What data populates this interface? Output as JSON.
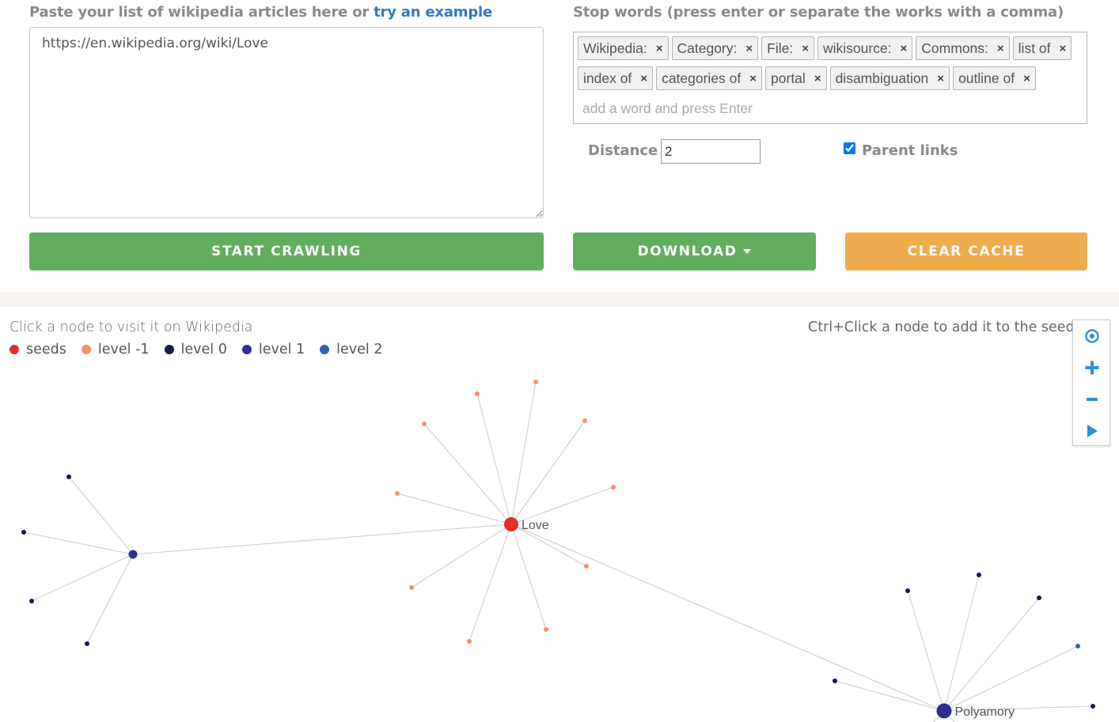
{
  "input_panel": {
    "heading_text": "Paste your list of wikipedia articles here or ",
    "example_link": "try an example",
    "articles_value": "https://en.wikipedia.org/wiki/Love"
  },
  "stopwords_panel": {
    "heading": "Stop words (press enter or separate the works with a comma)",
    "tags": [
      "Wikipedia:",
      "Category:",
      "File:",
      "wikisource:",
      "Commons:",
      "list of",
      "index of",
      "categories of",
      "portal",
      "disambiguation",
      "outline of"
    ],
    "remove_glyph": "×",
    "placeholder": "add a word and press Enter"
  },
  "options": {
    "distance_label": "Distance",
    "distance_value": "2",
    "parent_links_label": "Parent links",
    "parent_links_checked": true
  },
  "buttons": {
    "start": "START CRAWLING",
    "download": "DOWNLOAD",
    "clear": "CLEAR CACHE"
  },
  "colors": {
    "green": "#63ad5e",
    "orange": "#efac4d",
    "link": "#2f7ac7"
  },
  "graph": {
    "hint_left": "Click a node to visit it on Wikipedia",
    "hint_right": "Ctrl+Click a node to add it to the seeds",
    "legend": [
      {
        "label": "seeds",
        "color": "#e03028"
      },
      {
        "label": "level -1",
        "color": "#f4906a"
      },
      {
        "label": "level 0",
        "color": "#101c4d"
      },
      {
        "label": "level 1",
        "color": "#2c2e96"
      },
      {
        "label": "level 2",
        "color": "#2d64b0"
      }
    ],
    "controls": [
      "center-icon",
      "zoom-in-icon",
      "zoom-out-icon",
      "play-icon"
    ],
    "labeled_nodes": [
      {
        "label": "Love",
        "level": "seeds"
      },
      {
        "label": "Polyamory",
        "level": "level 1"
      }
    ]
  }
}
